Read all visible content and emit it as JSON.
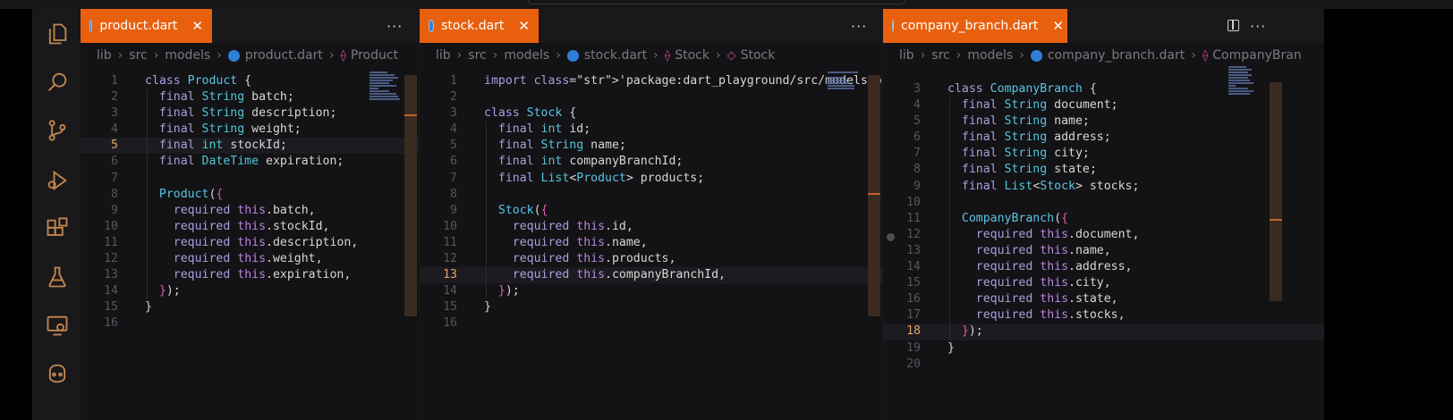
{
  "editors": [
    {
      "tab": "product.dart",
      "crumbs": [
        "lib",
        "src",
        "models",
        "product.dart",
        "Product"
      ],
      "lines": [
        {
          "n": "1",
          "code": "class Product {"
        },
        {
          "n": "2",
          "code": "  final String batch;"
        },
        {
          "n": "3",
          "code": "  final String description;"
        },
        {
          "n": "4",
          "code": "  final String weight;"
        },
        {
          "n": "5",
          "code": "  final int stockId;"
        },
        {
          "n": "6",
          "code": "  final DateTime expiration;"
        },
        {
          "n": "7",
          "code": ""
        },
        {
          "n": "8",
          "code": "  Product({"
        },
        {
          "n": "9",
          "code": "    required this.batch,"
        },
        {
          "n": "10",
          "code": "    required this.stockId,"
        },
        {
          "n": "11",
          "code": "    required this.description,"
        },
        {
          "n": "12",
          "code": "    required this.weight,"
        },
        {
          "n": "13",
          "code": "    required this.expiration,"
        },
        {
          "n": "14",
          "code": "  });"
        },
        {
          "n": "15",
          "code": "}"
        },
        {
          "n": "16",
          "code": ""
        }
      ]
    },
    {
      "tab": "stock.dart",
      "crumbs": [
        "lib",
        "src",
        "models",
        "stock.dart",
        "Stock",
        "Stock"
      ],
      "lines": [
        {
          "n": "1",
          "code": "import 'package:dart_playground/src/models/pr"
        },
        {
          "n": "2",
          "code": ""
        },
        {
          "n": "3",
          "code": "class Stock {"
        },
        {
          "n": "4",
          "code": "  final int id;"
        },
        {
          "n": "5",
          "code": "  final String name;"
        },
        {
          "n": "6",
          "code": "  final int companyBranchId;"
        },
        {
          "n": "7",
          "code": "  final List<Product> products;"
        },
        {
          "n": "8",
          "code": ""
        },
        {
          "n": "9",
          "code": "  Stock({"
        },
        {
          "n": "10",
          "code": "    required this.id,"
        },
        {
          "n": "11",
          "code": "    required this.name,"
        },
        {
          "n": "12",
          "code": "    required this.products,"
        },
        {
          "n": "13",
          "code": "    required this.companyBranchId,"
        },
        {
          "n": "14",
          "code": "  });"
        },
        {
          "n": "15",
          "code": "}"
        },
        {
          "n": "16",
          "code": ""
        }
      ]
    },
    {
      "tab": "company_branch.dart",
      "crumbs": [
        "lib",
        "src",
        "models",
        "company_branch.dart",
        "CompanyBran"
      ],
      "lines": [
        {
          "n": "3",
          "code": "class CompanyBranch {"
        },
        {
          "n": "4",
          "code": "  final String document;"
        },
        {
          "n": "5",
          "code": "  final String name;"
        },
        {
          "n": "6",
          "code": "  final String address;"
        },
        {
          "n": "7",
          "code": "  final String city;"
        },
        {
          "n": "8",
          "code": "  final String state;"
        },
        {
          "n": "9",
          "code": "  final List<Stock> stocks;"
        },
        {
          "n": "10",
          "code": ""
        },
        {
          "n": "11",
          "code": "  CompanyBranch({"
        },
        {
          "n": "12",
          "code": "    required this.document,"
        },
        {
          "n": "13",
          "code": "    required this.name,"
        },
        {
          "n": "14",
          "code": "    required this.address,"
        },
        {
          "n": "15",
          "code": "    required this.city,"
        },
        {
          "n": "16",
          "code": "    required this.state,"
        },
        {
          "n": "17",
          "code": "    required this.stocks,"
        },
        {
          "n": "18",
          "code": "  });"
        },
        {
          "n": "19",
          "code": "}"
        },
        {
          "n": "20",
          "code": ""
        }
      ]
    }
  ],
  "icons": {
    "activity": [
      "explorer-icon",
      "search-icon",
      "source-control-icon",
      "run-debug-icon",
      "extensions-icon",
      "testing-icon",
      "remote-explorer-icon",
      "copilot-icon"
    ],
    "more": "more-actions-icon",
    "split": "split-editor-icon",
    "tab_close": "close-icon"
  },
  "colors": {
    "accent": "#e8600e",
    "activity_icon": "#c2874e",
    "editor_bg": "#131215"
  }
}
